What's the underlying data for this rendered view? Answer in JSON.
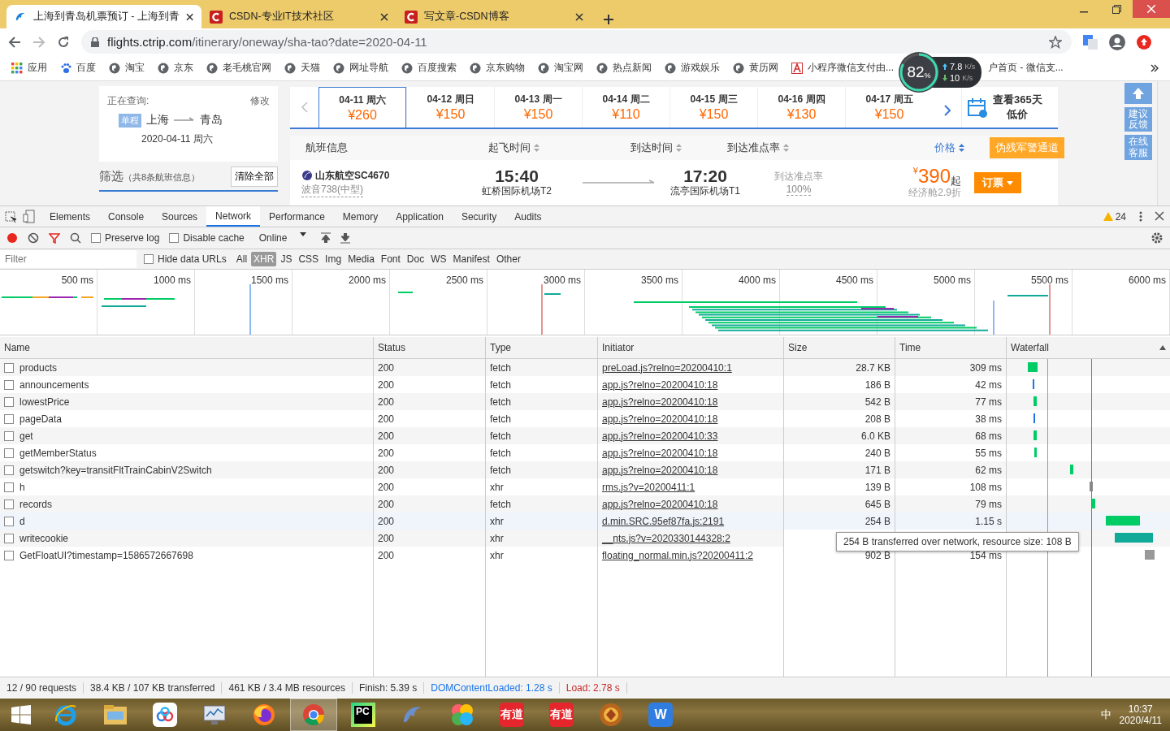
{
  "browser_tabs": [
    {
      "title": "上海到青岛机票预订 - 上海到青",
      "kind": "dolphin",
      "selected": true
    },
    {
      "title": "CSDN-专业IT技术社区",
      "kind": "csdn",
      "selected": false
    },
    {
      "title": "写文章-CSDN博客",
      "kind": "csdn",
      "selected": false
    }
  ],
  "address": {
    "host": "flights.ctrip.com",
    "path": "/itinerary/oneway/sha-tao?date=2020-04-11"
  },
  "bookmarks": [
    {
      "label": "应用",
      "kind": "apps"
    },
    {
      "label": "百度",
      "kind": "paw"
    },
    {
      "label": "淘宝",
      "kind": "globe"
    },
    {
      "label": "京东",
      "kind": "globe"
    },
    {
      "label": "老毛桃官网",
      "kind": "globe"
    },
    {
      "label": "天猫",
      "kind": "globe"
    },
    {
      "label": "网址导航",
      "kind": "globe"
    },
    {
      "label": "百度搜索",
      "kind": "globe"
    },
    {
      "label": "京东购物",
      "kind": "globe"
    },
    {
      "label": "淘宝网",
      "kind": "globe"
    },
    {
      "label": "热点新闻",
      "kind": "globe"
    },
    {
      "label": "游戏娱乐",
      "kind": "globe"
    },
    {
      "label": "黄历网",
      "kind": "globe"
    },
    {
      "label": "小程序微信支付由...",
      "kind": "letter"
    },
    {
      "label": "户首页 - 微信支...",
      "kind": "plain"
    }
  ],
  "speed_widget": {
    "percent": "82",
    "unit": "%",
    "up": "7.8",
    "up_unit": "K/s",
    "down": "10",
    "down_unit": "K/s"
  },
  "search_panel": {
    "label": "正在查询:",
    "edit": "修改",
    "trip_type": "单程",
    "from": "上海",
    "to": "青岛",
    "date": "2020-04-11 周六"
  },
  "dates": [
    {
      "date": "04-11 周六",
      "price": "¥260",
      "selected": true
    },
    {
      "date": "04-12 周日",
      "price": "¥150",
      "selected": false
    },
    {
      "date": "04-13 周一",
      "price": "¥150",
      "selected": false
    },
    {
      "date": "04-14 周二",
      "price": "¥110",
      "selected": false
    },
    {
      "date": "04-15 周三",
      "price": "¥150",
      "selected": false
    },
    {
      "date": "04-16 周四",
      "price": "¥130",
      "selected": false
    },
    {
      "date": "04-17 周五",
      "price": "¥150",
      "selected": false
    }
  ],
  "calendar_link": [
    "查看365天",
    "低价"
  ],
  "columns": [
    {
      "label": "航班信息",
      "sortable": false,
      "selected": false
    },
    {
      "label": "起飞时间",
      "sortable": true,
      "selected": false
    },
    {
      "label": "到达时间",
      "sortable": true,
      "selected": false
    },
    {
      "label": "到达准点率",
      "sortable": true,
      "selected": false
    },
    {
      "label": "价格",
      "sortable": true,
      "selected": true
    }
  ],
  "special_button": "伪残军警通道",
  "filter": {
    "title": "筛选",
    "count": "（共8条航班信息）",
    "clear": "清除全部"
  },
  "flight": {
    "airline": "山东航空SC4670",
    "aircraft": "波音738(中型)",
    "dep_time": "15:40",
    "dep_airport": "虹桥国际机场T2",
    "arr_time": "17:20",
    "arr_airport": "流亭国际机场T1",
    "ontime_label": "到达准点率",
    "ontime": "100%",
    "price_prefix": "¥",
    "price": "390",
    "price_suffix": "起",
    "discount": "经济舱2.9折",
    "book": "订票"
  },
  "side_buttons": [
    [
      "建议",
      "反馈"
    ],
    [
      "在线",
      "客服"
    ]
  ],
  "devtools": {
    "tabs": [
      {
        "label": "Elements",
        "selected": false
      },
      {
        "label": "Console",
        "selected": false
      },
      {
        "label": "Sources",
        "selected": false
      },
      {
        "label": "Network",
        "selected": true
      },
      {
        "label": "Performance",
        "selected": false
      },
      {
        "label": "Memory",
        "selected": false
      },
      {
        "label": "Application",
        "selected": false
      },
      {
        "label": "Security",
        "selected": false
      },
      {
        "label": "Audits",
        "selected": false
      }
    ],
    "warnings": "24",
    "preserve_log": {
      "label": "Preserve log",
      "checked": false
    },
    "disable_cache": {
      "label": "Disable cache",
      "checked": false
    },
    "throttle": "Online",
    "filter_placeholder": "Filter",
    "hide_data_urls": {
      "label": "Hide data URLs",
      "checked": false
    },
    "types": [
      {
        "label": "All",
        "selected": false
      },
      {
        "label": "XHR",
        "selected": true
      },
      {
        "label": "JS",
        "selected": false
      },
      {
        "label": "CSS",
        "selected": false
      },
      {
        "label": "Img",
        "selected": false
      },
      {
        "label": "Media",
        "selected": false
      },
      {
        "label": "Font",
        "selected": false
      },
      {
        "label": "Doc",
        "selected": false
      },
      {
        "label": "WS",
        "selected": false
      },
      {
        "label": "Manifest",
        "selected": false
      },
      {
        "label": "Other",
        "selected": false
      }
    ],
    "overview_ticks": [
      "500 ms",
      "1000 ms",
      "1500 ms",
      "2000 ms",
      "2500 ms",
      "3000 ms",
      "3500 ms",
      "4000 ms",
      "4500 ms",
      "5000 ms",
      "5500 ms",
      "6000 ms"
    ],
    "table": {
      "columns": [
        "Name",
        "Status",
        "Type",
        "Initiator",
        "Size",
        "Time",
        "Waterfall"
      ],
      "rows": [
        {
          "name": "products",
          "status": "200",
          "type": "fetch",
          "initiator": "preLoad.js?relno=20200410:1",
          "size": "28.7 KB",
          "time": "309 ms"
        },
        {
          "name": "announcements",
          "status": "200",
          "type": "fetch",
          "initiator": "app.js?relno=20200410:18",
          "size": "186 B",
          "time": "42 ms"
        },
        {
          "name": "lowestPrice",
          "status": "200",
          "type": "fetch",
          "initiator": "app.js?relno=20200410:18",
          "size": "542 B",
          "time": "77 ms"
        },
        {
          "name": "pageData",
          "status": "200",
          "type": "fetch",
          "initiator": "app.js?relno=20200410:18",
          "size": "208 B",
          "time": "38 ms"
        },
        {
          "name": "get",
          "status": "200",
          "type": "fetch",
          "initiator": "app.js?relno=20200410:33",
          "size": "6.0 KB",
          "time": "68 ms"
        },
        {
          "name": "getMemberStatus",
          "status": "200",
          "type": "fetch",
          "initiator": "app.js?relno=20200410:18",
          "size": "240 B",
          "time": "55 ms"
        },
        {
          "name": "getswitch?key=transitFltTrainCabinV2Switch",
          "status": "200",
          "type": "fetch",
          "initiator": "app.js?relno=20200410:18",
          "size": "171 B",
          "time": "62 ms"
        },
        {
          "name": "h",
          "status": "200",
          "type": "xhr",
          "initiator": "rms.js?v=20200411:1",
          "size": "139 B",
          "time": "108 ms"
        },
        {
          "name": "records",
          "status": "200",
          "type": "fetch",
          "initiator": "app.js?relno=20200410:18",
          "size": "645 B",
          "time": "79 ms"
        },
        {
          "name": "d",
          "status": "200",
          "type": "xhr",
          "initiator": "d.min.SRC.95ef87fa.js:2191",
          "size": "254 B",
          "time": "1.15 s"
        },
        {
          "name": "writecookie",
          "status": "200",
          "type": "xhr",
          "initiator": "__nts.js?v=2020330144328:2"
        },
        {
          "name": "GetFloatUI?timestamp=1586572667698",
          "status": "200",
          "type": "xhr",
          "initiator": "floating_normal.min.js?20200411:2",
          "size": "902 B",
          "time": "154 ms"
        }
      ]
    },
    "tooltip": "254 B transferred over network, resource size: 108 B",
    "status_bar": [
      {
        "text": "12 / 90 requests",
        "color": "#333333"
      },
      {
        "text": "38.4 KB / 107 KB transferred",
        "color": "#333333"
      },
      {
        "text": "461 KB / 3.4 MB resources",
        "color": "#333333"
      },
      {
        "text": "Finish: 5.39 s",
        "color": "#333333"
      },
      {
        "text": "DOMContentLoaded: 1.28 s",
        "color": "#1a73e8"
      },
      {
        "text": "Load: 2.78 s",
        "color": "#c62828"
      }
    ]
  },
  "taskbar": {
    "apps": [
      {
        "kind": "ie",
        "selected": false
      },
      {
        "kind": "folder",
        "selected": false
      },
      {
        "kind": "cloud",
        "selected": false
      },
      {
        "kind": "monitor",
        "selected": false
      },
      {
        "kind": "firefox",
        "selected": false
      },
      {
        "kind": "chrome",
        "selected": true
      },
      {
        "kind": "pycharm",
        "label": "PC",
        "selected": false
      },
      {
        "kind": "dolphin",
        "selected": false
      },
      {
        "kind": "petals",
        "selected": false
      },
      {
        "kind": "youdao",
        "label": "有道",
        "selected": false
      },
      {
        "kind": "youdao",
        "label": "有道",
        "selected": false
      },
      {
        "kind": "game",
        "selected": false
      },
      {
        "kind": "wps",
        "label": "W",
        "selected": false
      }
    ],
    "ime": "中",
    "time": "10:37",
    "date": "2020/4/11"
  }
}
